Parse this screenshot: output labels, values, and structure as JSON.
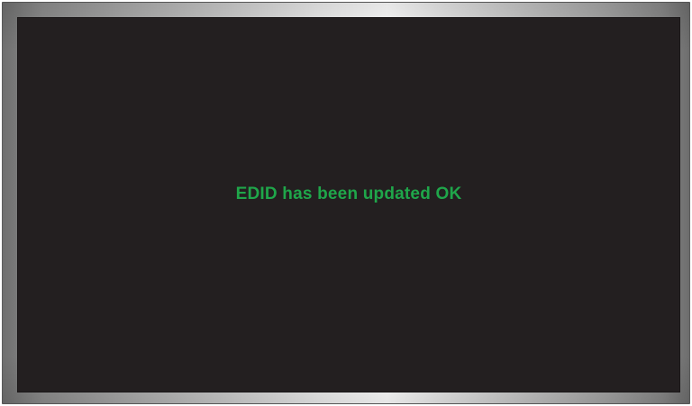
{
  "screen": {
    "message": "EDID has been updated OK"
  },
  "colors": {
    "screen_background": "#231f20",
    "message_text": "#1fa64a",
    "bezel_highlight": "#ffffff",
    "bezel_shadow": "#6f6f6f"
  }
}
